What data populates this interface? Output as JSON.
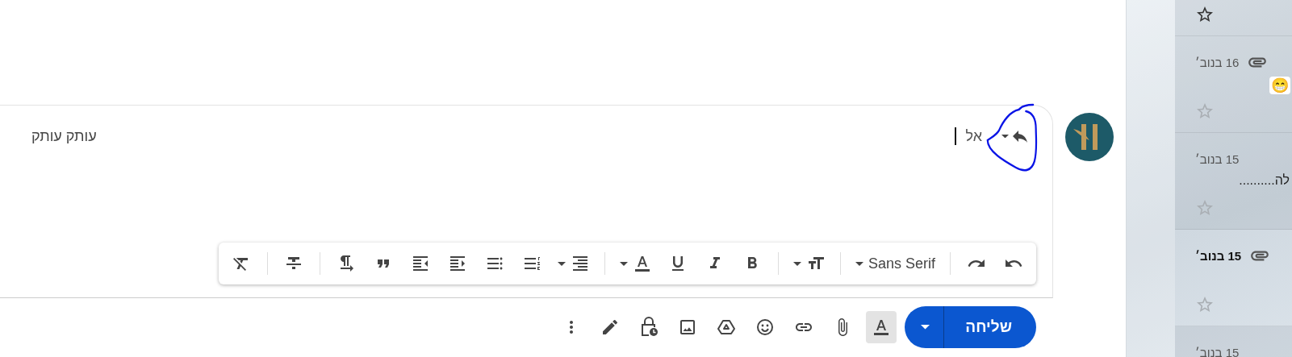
{
  "compose": {
    "to_label": "אל",
    "cc_text": "עותק עותק",
    "toolbar": [
      {
        "kind": "undo"
      },
      {
        "kind": "redo"
      },
      {
        "kind": "separator"
      },
      {
        "kind": "font",
        "label": "Sans Serif"
      },
      {
        "kind": "separator"
      },
      {
        "kind": "size"
      },
      {
        "kind": "separator"
      },
      {
        "kind": "bold"
      },
      {
        "kind": "italic"
      },
      {
        "kind": "underline"
      },
      {
        "kind": "text_color"
      },
      {
        "kind": "separator"
      },
      {
        "kind": "align"
      },
      {
        "kind": "numbered_list"
      },
      {
        "kind": "bulleted_list"
      },
      {
        "kind": "indent_less"
      },
      {
        "kind": "indent_more"
      },
      {
        "kind": "quote"
      },
      {
        "kind": "text_direction"
      },
      {
        "kind": "separator"
      },
      {
        "kind": "strikethrough"
      },
      {
        "kind": "separator"
      },
      {
        "kind": "remove_format"
      }
    ],
    "send_label": "שליחה",
    "actions": [
      {
        "kind": "formatting",
        "selected": true
      },
      {
        "kind": "attach",
        "selected": false
      },
      {
        "kind": "link",
        "selected": false
      },
      {
        "kind": "emoji",
        "selected": false
      },
      {
        "kind": "drive",
        "selected": false
      },
      {
        "kind": "photo",
        "selected": false
      },
      {
        "kind": "confidential",
        "selected": false
      },
      {
        "kind": "signature",
        "selected": false
      },
      {
        "kind": "more",
        "selected": false
      }
    ]
  },
  "mail_list": [
    {
      "unread": false,
      "highlighted": true
    },
    {
      "date": "16 בנוב׳",
      "snippet": "😁",
      "unread": false,
      "highlighted": false,
      "attachment": true
    },
    {
      "date": "15 בנוב׳",
      "snippet": "לה..........",
      "unread": false,
      "highlighted": false,
      "attachment": false
    },
    {
      "date": "15 בנוב׳",
      "unread": true,
      "highlighted": false,
      "attachment": true
    },
    {
      "date": "15 בנוב׳",
      "unread": false,
      "attachment": false
    }
  ]
}
